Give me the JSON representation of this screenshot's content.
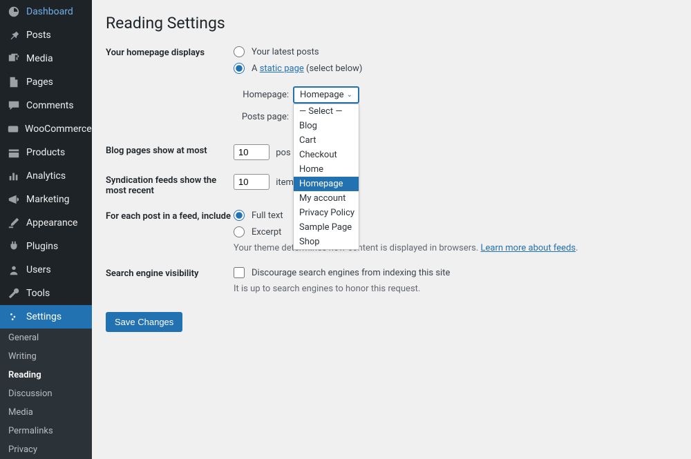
{
  "sidebar": {
    "items": [
      {
        "label": "Dashboard"
      },
      {
        "label": "Posts"
      },
      {
        "label": "Media"
      },
      {
        "label": "Pages"
      },
      {
        "label": "Comments"
      },
      {
        "label": "WooCommerce"
      },
      {
        "label": "Products"
      },
      {
        "label": "Analytics"
      },
      {
        "label": "Marketing"
      },
      {
        "label": "Appearance"
      },
      {
        "label": "Plugins"
      },
      {
        "label": "Users"
      },
      {
        "label": "Tools"
      },
      {
        "label": "Settings"
      }
    ],
    "sub": [
      "General",
      "Writing",
      "Reading",
      "Discussion",
      "Media",
      "Permalinks",
      "Privacy"
    ]
  },
  "page": {
    "title": "Reading Settings",
    "homepage_label": "Your homepage displays",
    "radio_latest": "Your latest posts",
    "radio_static_prefix": "A ",
    "radio_static_link": "static page",
    "radio_static_suffix": " (select below)",
    "homepage_select_label": "Homepage:",
    "homepage_select_value": "Homepage",
    "posts_select_label": "Posts page:",
    "dropdown_options": [
      "— Select —",
      "Blog",
      "Cart",
      "Checkout",
      "Home",
      "Homepage",
      "My account",
      "Privacy Policy",
      "Sample Page",
      "Shop"
    ],
    "blog_pages_label": "Blog pages show at most",
    "blog_pages_value": "10",
    "blog_pages_unit": "pos",
    "syndication_label": "Syndication feeds show the most recent",
    "syndication_value": "10",
    "syndication_unit": "item",
    "feed_label": "For each post in a feed, include",
    "feed_full": "Full text",
    "feed_excerpt": "Excerpt",
    "feed_desc_prefix": "Your theme determines how content is displayed in browsers. ",
    "feed_desc_link": "Learn more about feeds",
    "feed_desc_suffix": ".",
    "search_label": "Search engine visibility",
    "search_checkbox": "Discourage search engines from indexing this site",
    "search_desc": "It is up to search engines to honor this request.",
    "save": "Save Changes"
  }
}
